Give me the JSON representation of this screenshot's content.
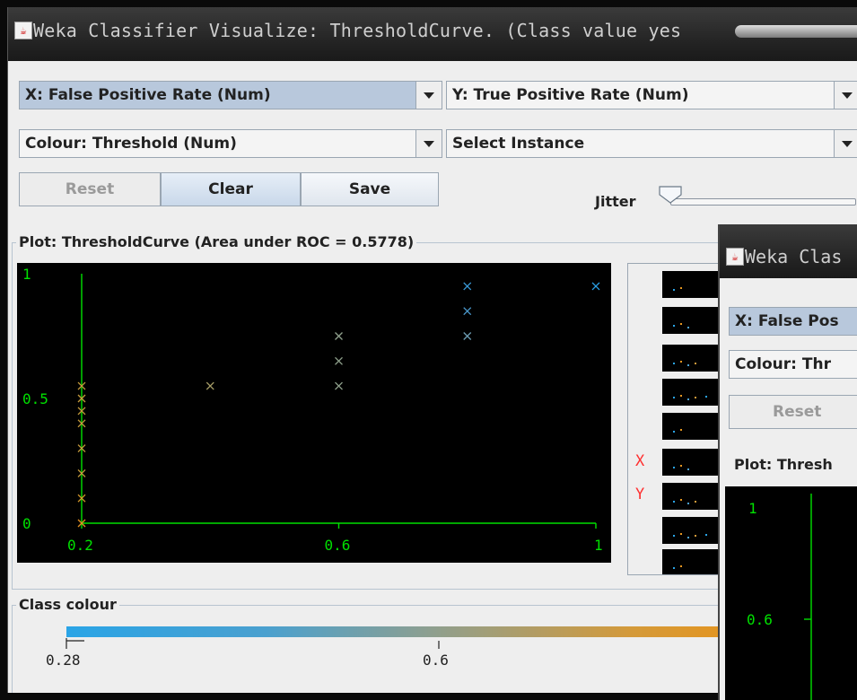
{
  "window": {
    "title": "Weka Classifier Visualize: ThresholdCurve. (Class value yes"
  },
  "controls": {
    "x_axis": "X: False Positive Rate (Num)",
    "y_axis": "Y: True Positive Rate (Num)",
    "colour": "Colour: Threshold (Num)",
    "select_instance": "Select Instance",
    "reset": "Reset",
    "clear": "Clear",
    "save": "Save",
    "jitter": "Jitter"
  },
  "plot": {
    "title": "Plot: ThresholdCurve (Area under ROC = 0.5778)",
    "y_ticks": [
      "1",
      "0.5",
      "0"
    ],
    "x_ticks": [
      "0.2",
      "0.6",
      "1"
    ]
  },
  "chart_data": {
    "type": "scatter",
    "title": "Plot: ThresholdCurve (Area under ROC = 0.5778)",
    "xlabel": "False Positive Rate",
    "ylabel": "True Positive Rate",
    "xlim": [
      0.2,
      1.0
    ],
    "ylim": [
      0,
      1
    ],
    "colour_by": "Threshold",
    "points": [
      {
        "x": 0.2,
        "y": 0.0,
        "c": "#e09020"
      },
      {
        "x": 0.2,
        "y": 0.1,
        "c": "#d49a2a"
      },
      {
        "x": 0.2,
        "y": 0.2,
        "c": "#c59d3c"
      },
      {
        "x": 0.2,
        "y": 0.3,
        "c": "#c59d3c"
      },
      {
        "x": 0.2,
        "y": 0.4,
        "c": "#c59d3c"
      },
      {
        "x": 0.2,
        "y": 0.45,
        "c": "#c59d3c"
      },
      {
        "x": 0.2,
        "y": 0.5,
        "c": "#c59d3c"
      },
      {
        "x": 0.2,
        "y": 0.55,
        "c": "#c59d3c"
      },
      {
        "x": 0.4,
        "y": 0.55,
        "c": "#a89e68"
      },
      {
        "x": 0.6,
        "y": 0.55,
        "c": "#8fa08c"
      },
      {
        "x": 0.6,
        "y": 0.65,
        "c": "#8fa08c"
      },
      {
        "x": 0.6,
        "y": 0.75,
        "c": "#8fa08c"
      },
      {
        "x": 0.8,
        "y": 0.75,
        "c": "#6c9cb2"
      },
      {
        "x": 0.8,
        "y": 0.85,
        "c": "#4a98cc"
      },
      {
        "x": 0.8,
        "y": 0.95,
        "c": "#3a9ad8"
      },
      {
        "x": 1.0,
        "y": 0.95,
        "c": "#2aa0e6"
      }
    ]
  },
  "legend": {
    "x": "X",
    "y": "Y"
  },
  "class_colour": {
    "title": "Class colour",
    "ticks": [
      "0.28",
      "0.6"
    ]
  },
  "second_window": {
    "title": "Weka Clas",
    "x_axis": "X: False Pos",
    "colour": "Colour: Thr",
    "reset": "Reset",
    "plot_title": "Plot: Thresh",
    "y_ticks": [
      "1",
      "0.6"
    ]
  }
}
